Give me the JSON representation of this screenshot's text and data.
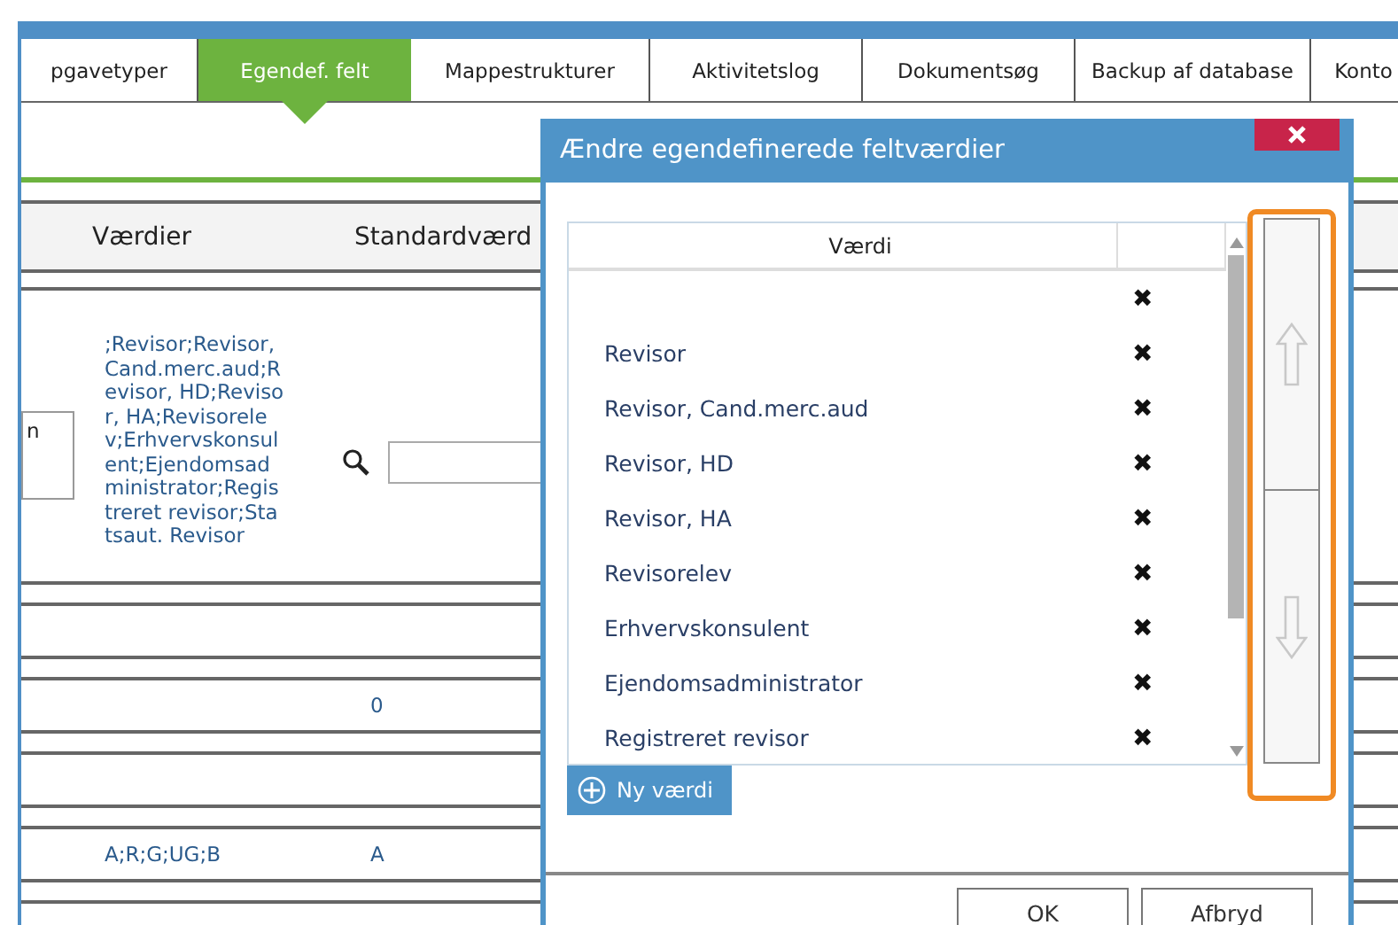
{
  "tabs": [
    {
      "label": "pgavetyper",
      "selected": false
    },
    {
      "label": "Egendef. felt",
      "selected": true
    },
    {
      "label": "Mappestrukturer",
      "selected": false
    },
    {
      "label": "Aktivitetslog",
      "selected": false
    },
    {
      "label": "Dokumentsøg",
      "selected": false
    },
    {
      "label": "Backup af database",
      "selected": false
    },
    {
      "label": "Konto",
      "selected": false
    }
  ],
  "table": {
    "columns": [
      "Værdier",
      "Standardværd"
    ],
    "rows": [
      {
        "kind": "lookup",
        "field": "n",
        "values": ";Revisor;Revisor, Cand.merc.aud;Revisor, HD;Revisor, HA;Revisorelev;Erhvervskonsulent;Ejendomsadministrator;Registreret revisor;Statsaut. Revisor"
      },
      {
        "kind": "text",
        "default": "0"
      },
      {
        "kind": "text",
        "values": "A;R;G;UG;B",
        "default": "A"
      }
    ]
  },
  "dialog": {
    "title": "Ændre egendefinerede feltværdier",
    "grid": {
      "columns": [
        "Værdi"
      ],
      "rows": [
        {
          "delete": "✖"
        },
        {
          "value": "Revisor",
          "delete": "✖"
        },
        {
          "value": "Revisor, Cand.merc.aud",
          "delete": "✖"
        },
        {
          "value": "Revisor, HD",
          "delete": "✖"
        },
        {
          "value": "Revisor, HA",
          "delete": "✖"
        },
        {
          "value": "Revisorelev",
          "delete": "✖"
        },
        {
          "value": "Erhvervskonsulent",
          "delete": "✖"
        },
        {
          "value": "Ejendomsadministrator",
          "delete": "✖"
        },
        {
          "value": "Registreret revisor",
          "delete": "✖"
        }
      ]
    },
    "add_button": "Ny værdi",
    "buttons": [
      "OK",
      "Afbryd"
    ]
  }
}
